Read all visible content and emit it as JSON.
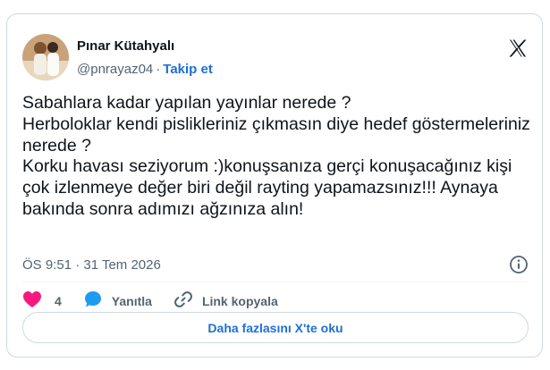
{
  "author": {
    "name": "Pınar Kütahyalı",
    "handle": "@pnrayaz04",
    "separator": "·",
    "follow_label": "Takip et"
  },
  "tweet": {
    "text": "Sabahlara kadar yapılan yayınlar nerede ?\nHerboloklar  kendi pislikleriniz çıkmasın diye hedef göstermeleriniz nerede ?\nKorku havası seziyorum :)konuşsanıza gerçi konuşacağınız kişi çok izlenmeye değer biri değil rayting yapamazsınız!!! Aynaya bakında sonra adımızı ağzınıza alın!",
    "timestamp": "ÖS 9:51 · 31 Tem 2026"
  },
  "actions": {
    "like_count": "4",
    "reply_label": "Yanıtla",
    "copy_link_label": "Link kopyala"
  },
  "read_more_label": "Daha fazlasını X'te oku",
  "colors": {
    "like": "#f91880",
    "reply": "#1d9bf0",
    "link": "#1d6fd8",
    "muted": "#536471"
  },
  "icons": [
    "x-logo-icon",
    "info-icon",
    "heart-icon",
    "reply-bubble-icon",
    "link-icon"
  ]
}
